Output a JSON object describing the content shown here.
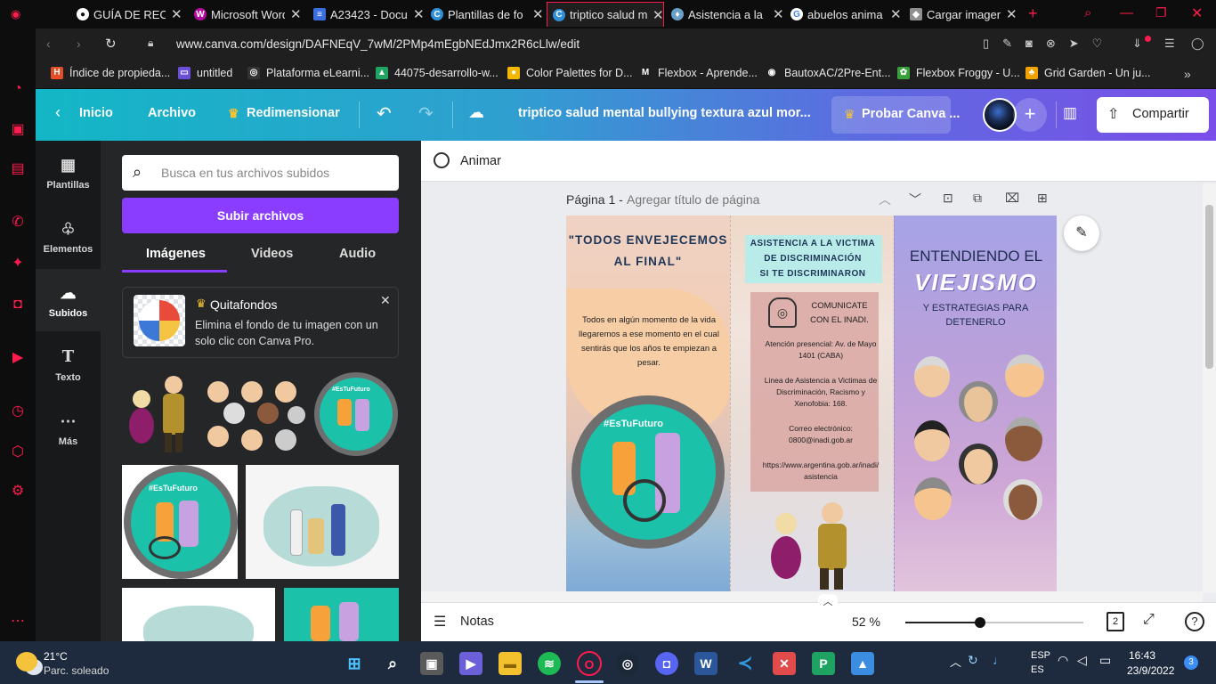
{
  "tabs": [
    {
      "label": "GUÍA DE RECU",
      "color": "#ffffff",
      "glyph": "●"
    },
    {
      "label": "Microsoft Word",
      "color": "#b40aa3",
      "glyph": "W"
    },
    {
      "label": "A23423 - Docu",
      "color": "#3b6fe0",
      "glyph": "≡"
    },
    {
      "label": "Plantillas de fo",
      "color": "#2f8fd8",
      "glyph": "C"
    },
    {
      "label": "triptico salud m",
      "color": "#2f8fd8",
      "glyph": "C"
    },
    {
      "label": "Asistencia a la",
      "color": "#6aa0c8",
      "glyph": "♦"
    },
    {
      "label": "abuelos anima",
      "color": "#ffffff",
      "glyph": "G"
    },
    {
      "label": "Cargar imagen",
      "color": "#8f8f8f",
      "glyph": "◆"
    }
  ],
  "address": {
    "url": "www.canva.com/design/DAFNEqV_7wM/2PMp4mEgbNEdJmx2R6cLlw/edit"
  },
  "bookmarks": [
    {
      "label": "Índice de propieda...",
      "color": "#e44d26",
      "glyph": "H"
    },
    {
      "label": "untitled",
      "color": "#6b4fd8",
      "glyph": "▭"
    },
    {
      "label": "Plataforma eLearni...",
      "color": "#333333",
      "glyph": "◎"
    },
    {
      "label": "44075-desarrollo-w...",
      "color": "#1fa463",
      "glyph": "▲"
    },
    {
      "label": "Color Palettes for D...",
      "color": "#f5b800",
      "glyph": "●"
    },
    {
      "label": "Flexbox - Aprende...",
      "color": "#1f1f1f",
      "glyph": "M"
    },
    {
      "label": "BautoxAC/2Pre-Ent...",
      "color": "#1f1f1f",
      "glyph": "◉"
    },
    {
      "label": "Flexbox Froggy - U...",
      "color": "#39a13a",
      "glyph": "✿"
    },
    {
      "label": "Grid Garden - Un ju...",
      "color": "#f0a200",
      "glyph": "♣"
    }
  ],
  "canva_header": {
    "back_label": "Inicio",
    "file_label": "Archivo",
    "resize_label": "Redimensionar",
    "doc_title": "triptico salud mental bullying textura azul mor...",
    "try_pro_label": "Probar Canva ...",
    "share_label": "Compartir"
  },
  "rail": [
    {
      "label": "Plantillas",
      "icon": "template-icon"
    },
    {
      "label": "Elementos",
      "icon": "shapes-icon"
    },
    {
      "label": "Subidos",
      "icon": "upload-cloud-icon"
    },
    {
      "label": "Texto",
      "icon": "text-icon"
    },
    {
      "label": "Más",
      "icon": "more-icon"
    }
  ],
  "panel": {
    "search_placeholder": "Busca en tus archivos subidos",
    "upload_label": "Subir archivos",
    "tabs": [
      "Imágenes",
      "Videos",
      "Audio"
    ],
    "promo_title": "Quitafondos",
    "promo_text": "Elimina el fondo de tu imagen con un solo clic con Canva Pro."
  },
  "workspace": {
    "animate_label": "Animar",
    "page_label": "Página 1 -",
    "page_title_placeholder": "Agregar título de página",
    "notes_label": "Notas",
    "zoom": "52 %",
    "zoom_fraction": 0.52,
    "page_count": "2"
  },
  "design": {
    "panel1": {
      "heading_line1": "\"TODOS ENVEJECEMOS",
      "heading_line2": "AL FINAL\"",
      "body": "Todos en algún momento de la vida llegaremos a ese momento en el cual sentirás que los años te empiezan a pesar.",
      "badge": "#EsTuFuturo"
    },
    "panel2": {
      "heading_line1": "ASISTENCIA A LA VICTIMA",
      "heading_line2": "DE DISCRIMINACIÓN",
      "heading_line3": "SI TE DISCRIMINARON",
      "contact_line1": "COMUNICATE",
      "contact_line2": "CON EL INADI.",
      "info1": "Atención presencial: Av. de Mayo 1401 (CABA)",
      "info2": "Linea de Asistencia a Victimas de Discriminación, Racismo y Xenofobia: 168.",
      "info3": "Correo electrónico: 0800@inadi.gob.ar",
      "info4": "https://www.argentina.gob.ar/inadi/asistencia"
    },
    "panel3": {
      "title_line1": "ENTENDIENDO EL",
      "title_line2": "VIEJISMO",
      "subtitle": "Y ESTRATEGIAS PARA DETENERLO"
    }
  },
  "thumbnails": {
    "badge": "#EsTuFuturo"
  },
  "taskbar": {
    "weather_temp": "21°C",
    "weather_desc": "Parc. soleado",
    "lang1": "ESP",
    "lang2": "ES",
    "time": "16:43",
    "date": "23/9/2022",
    "notif_count": "3"
  }
}
